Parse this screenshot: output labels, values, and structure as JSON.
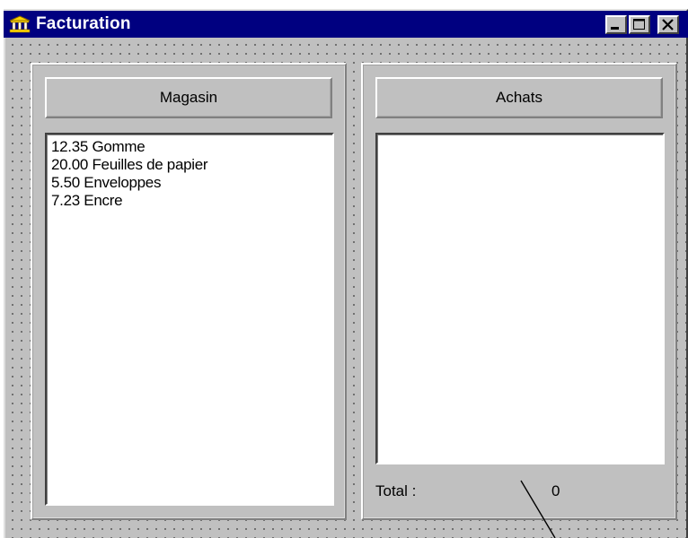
{
  "window": {
    "title": "Facturation",
    "icon": "building-icon",
    "controls": [
      "minimize-icon",
      "maximize-icon",
      "close-icon"
    ]
  },
  "store": {
    "header": "Magasin",
    "items": [
      {
        "label": "12.35 Gomme"
      },
      {
        "label": "20.00 Feuilles de papier"
      },
      {
        "label": "5.50 Enveloppes"
      },
      {
        "label": "7.23 Encre"
      }
    ]
  },
  "purchases": {
    "header": "Achats",
    "items": [],
    "total_label": "Total :",
    "total_value": "0"
  },
  "colors": {
    "titlebar": "#000080",
    "face": "#c0c0c0",
    "list_bg": "#ffffff"
  }
}
